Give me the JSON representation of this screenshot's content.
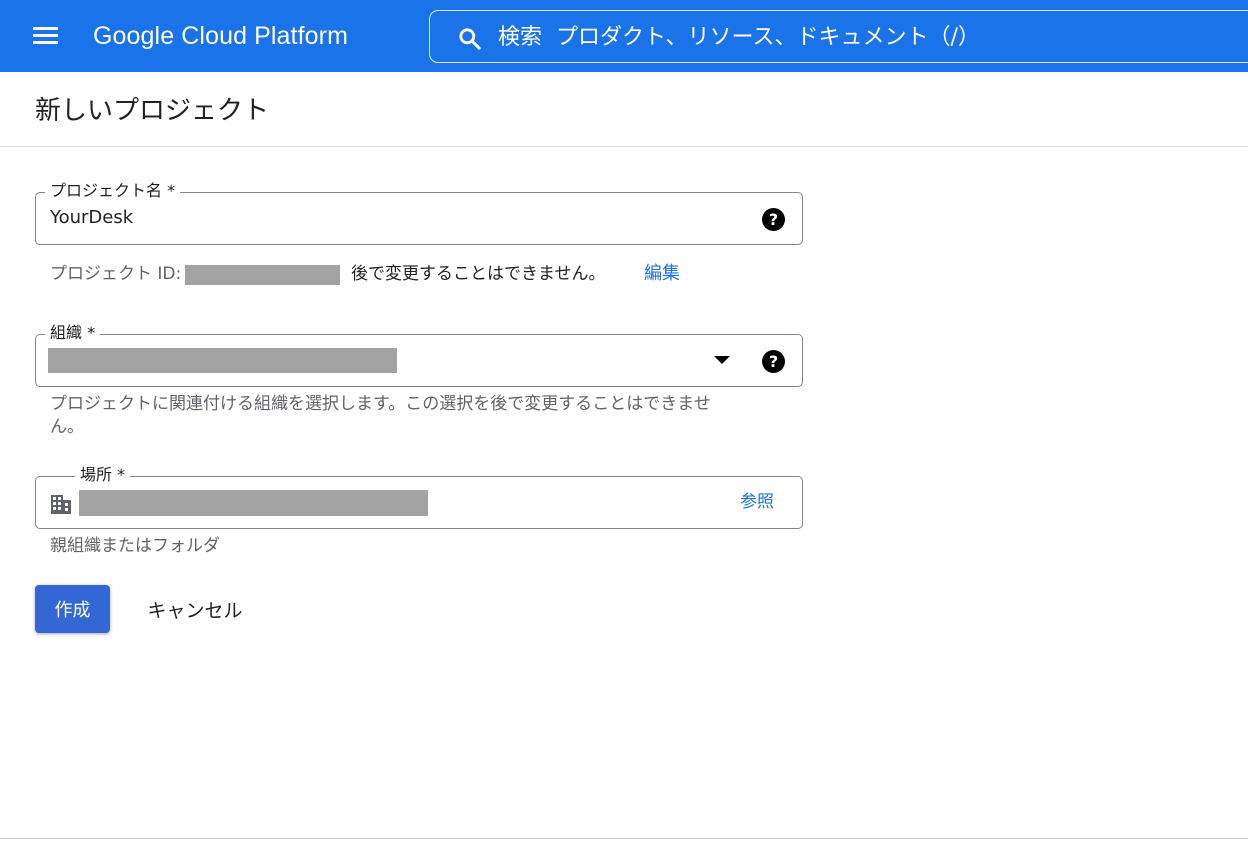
{
  "topbar": {
    "brand": "Google Cloud Platform",
    "search_placeholder": "検索  プロダクト、リソース、ドキュメント（/）",
    "accent_color": "#1a73e8",
    "icons": {
      "menu": "hamburger-menu-icon",
      "search": "search-icon"
    }
  },
  "page": {
    "title": "新しいプロジェクト"
  },
  "form": {
    "project_name": {
      "label": "プロジェクト名 *",
      "value": "YourDesk"
    },
    "project_id": {
      "prefix": "プロジェクト ID:",
      "suffix": "後で変更することはできません。",
      "edit_link": "編集"
    },
    "organization": {
      "label": "組織 *",
      "hint_line1": "プロジェクトに関連付ける組織を選択します。この選択を後で変更することはできませ",
      "hint_line2": "ん。"
    },
    "location": {
      "label": "場所 *",
      "browse_link": "参照",
      "hint": "親組織またはフォルダ"
    }
  },
  "actions": {
    "create_label": "作成",
    "cancel_label": "キャンセル",
    "create_color": "#3367d6"
  }
}
